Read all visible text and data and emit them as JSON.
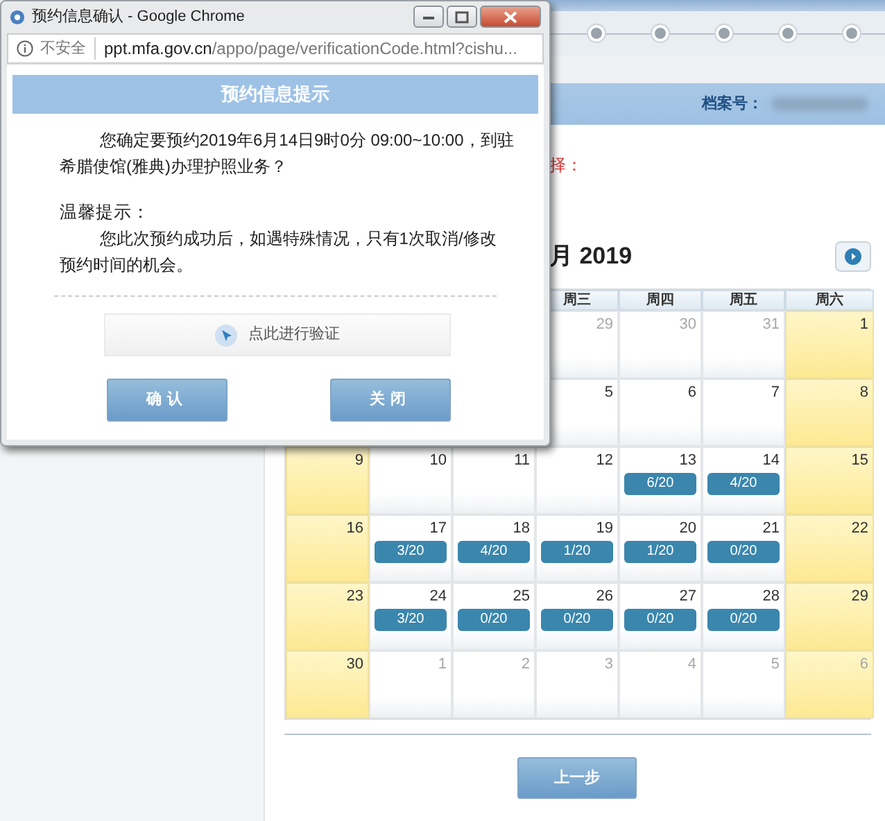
{
  "page": {
    "archive_label": "档案号：",
    "notice_fragment": "择：",
    "month_title": "月 2019",
    "calendar": {
      "weekdays": [
        "周三",
        "周四",
        "周五",
        "周六"
      ],
      "weeks": [
        [
          {
            "day": "29",
            "muted": true
          },
          {
            "day": "30",
            "muted": true
          },
          {
            "day": "31",
            "muted": true
          },
          {
            "day": "1",
            "muted": false
          }
        ],
        [
          {
            "day": "5",
            "muted": false
          },
          {
            "day": "6",
            "muted": false
          },
          {
            "day": "7",
            "muted": false
          },
          {
            "day": "8",
            "muted": false
          }
        ],
        [
          {
            "day": "9",
            "muted": false
          },
          {
            "day": "10",
            "muted": false
          },
          {
            "day": "11",
            "muted": false
          },
          {
            "day": "12",
            "muted": false
          },
          {
            "day": "13",
            "muted": false,
            "quota": "6/20"
          },
          {
            "day": "14",
            "muted": false,
            "quota": "4/20"
          },
          {
            "day": "15",
            "muted": false
          }
        ],
        [
          {
            "day": "16",
            "muted": false
          },
          {
            "day": "17",
            "muted": false,
            "quota": "3/20"
          },
          {
            "day": "18",
            "muted": false,
            "quota": "4/20"
          },
          {
            "day": "19",
            "muted": false,
            "quota": "1/20"
          },
          {
            "day": "20",
            "muted": false,
            "quota": "1/20"
          },
          {
            "day": "21",
            "muted": false,
            "quota": "0/20"
          },
          {
            "day": "22",
            "muted": false
          }
        ],
        [
          {
            "day": "23",
            "muted": false
          },
          {
            "day": "24",
            "muted": false,
            "quota": "3/20"
          },
          {
            "day": "25",
            "muted": false,
            "quota": "0/20"
          },
          {
            "day": "26",
            "muted": false,
            "quota": "0/20"
          },
          {
            "day": "27",
            "muted": false,
            "quota": "0/20"
          },
          {
            "day": "28",
            "muted": false,
            "quota": "0/20"
          },
          {
            "day": "29",
            "muted": false
          }
        ],
        [
          {
            "day": "30",
            "muted": false
          },
          {
            "day": "1",
            "muted": true
          },
          {
            "day": "2",
            "muted": true
          },
          {
            "day": "3",
            "muted": true
          },
          {
            "day": "4",
            "muted": true
          },
          {
            "day": "5",
            "muted": true
          },
          {
            "day": "6",
            "muted": true
          }
        ]
      ]
    },
    "back_button": "上一步"
  },
  "popup": {
    "title": "预约信息确认 - Google Chrome",
    "security_label": "不安全",
    "url_host": "ppt.mfa.gov.cn",
    "url_path": "/appo/page/verificationCode.html?cishu...",
    "heading": "预约信息提示",
    "message": "您确定要预约2019年6月14日9时0分 09:00~10:00，到驻希腊使馆(雅典)办理护照业务？",
    "tip_label": "温馨提示：",
    "tip": "您此次预约成功后，如遇特殊情况，只有1次取消/修改预约时间的机会。",
    "verify_button": "点此进行验证",
    "buttons": [
      "确认",
      "关闭"
    ]
  }
}
